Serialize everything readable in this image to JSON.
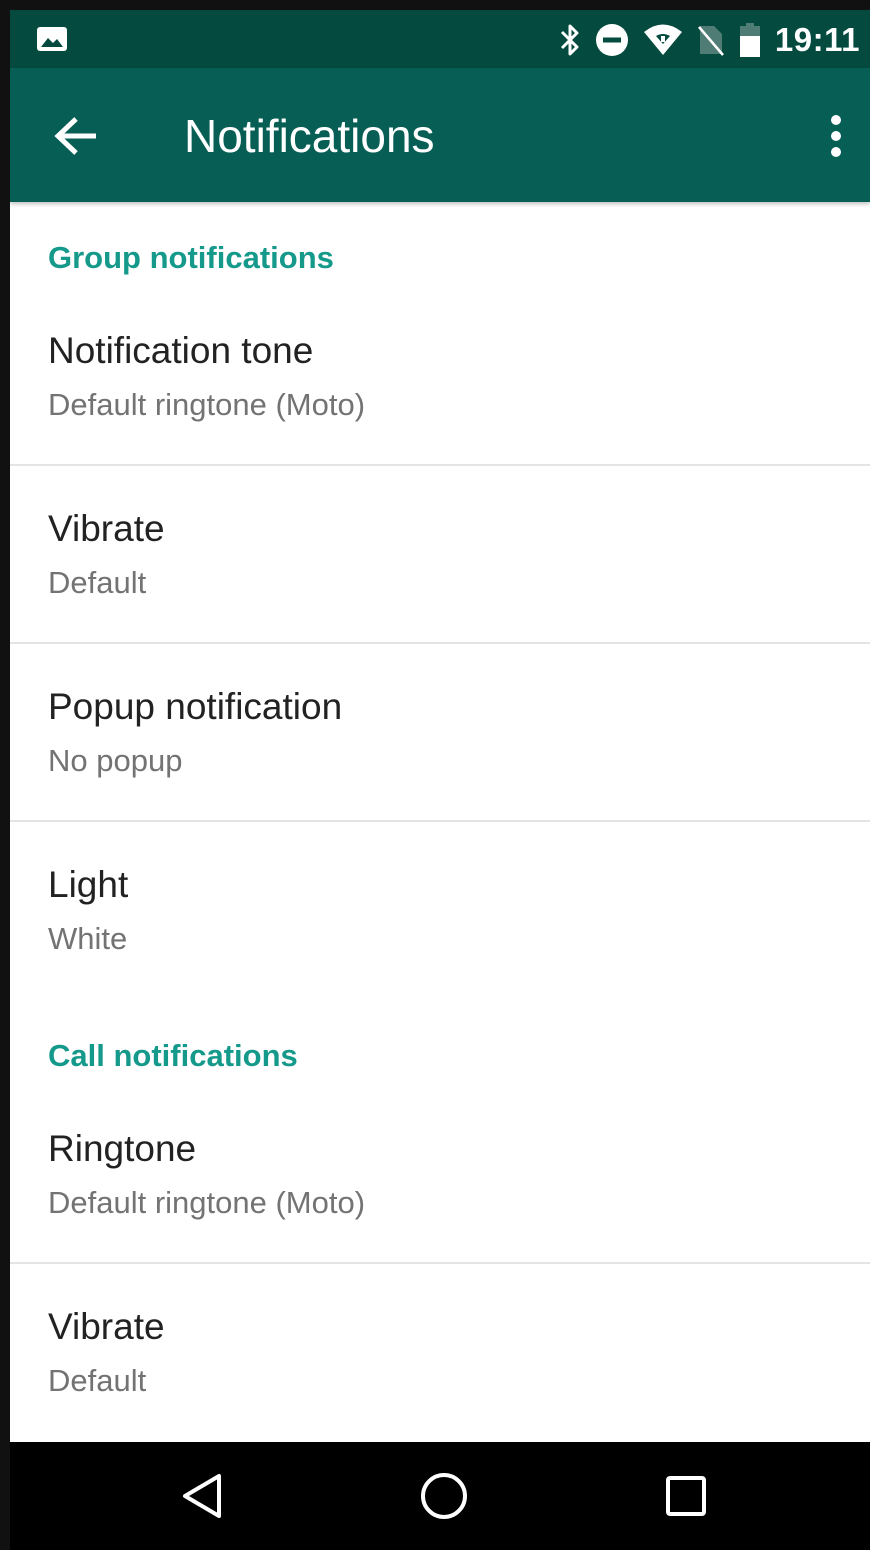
{
  "status_bar": {
    "time": "19:11",
    "icons": [
      "image-icon",
      "bluetooth-icon",
      "do-not-disturb-icon",
      "wifi-icon",
      "no-sim-icon",
      "battery-icon"
    ]
  },
  "app_bar": {
    "title": "Notifications",
    "back_icon": "arrow-left-icon",
    "menu_icon": "more-vertical-icon",
    "color": "#075e54"
  },
  "sections": [
    {
      "header": "Group notifications",
      "items": [
        {
          "title": "Notification tone",
          "summary": "Default ringtone (Moto)"
        },
        {
          "title": "Vibrate",
          "summary": "Default"
        },
        {
          "title": "Popup notification",
          "summary": "No popup"
        },
        {
          "title": "Light",
          "summary": "White"
        }
      ]
    },
    {
      "header": "Call notifications",
      "items": [
        {
          "title": "Ringtone",
          "summary": "Default ringtone (Moto)"
        },
        {
          "title": "Vibrate",
          "summary": "Default"
        }
      ]
    }
  ],
  "nav_bar": {
    "buttons": [
      "back-triangle-icon",
      "home-circle-icon",
      "recents-square-icon"
    ]
  },
  "accent_color": "#14998a"
}
